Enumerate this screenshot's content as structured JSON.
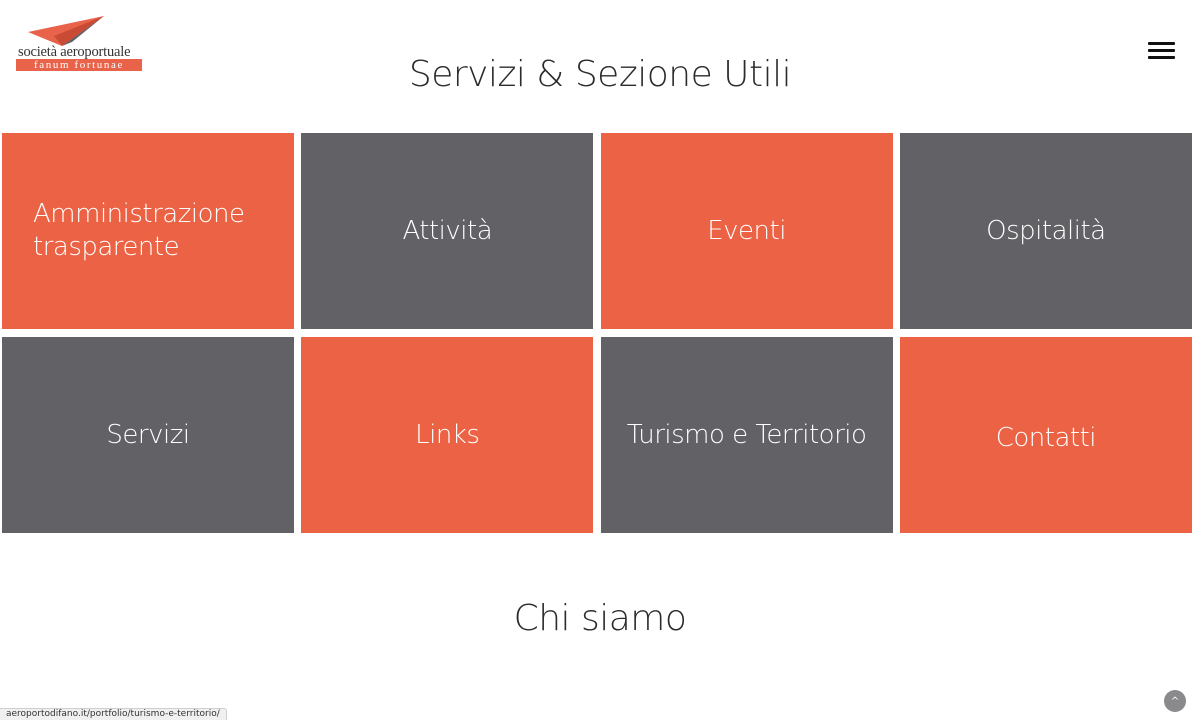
{
  "logo": {
    "line1": "società aeroportuale",
    "line2": "fanum fortunae"
  },
  "header": {
    "menu_icon": "hamburger-menu-icon"
  },
  "sections": {
    "services_title": "Servizi & Sezione Utili",
    "about_title": "Chi siamo"
  },
  "tiles": [
    {
      "label": "Amministrazione trasparente",
      "color": "#ec6245"
    },
    {
      "label": "Attività",
      "color": "#626166"
    },
    {
      "label": "Eventi",
      "color": "#ec6245"
    },
    {
      "label": "Ospitalità",
      "color": "#626166"
    },
    {
      "label": "Servizi",
      "color": "#626166"
    },
    {
      "label": "Links",
      "color": "#ec6245"
    },
    {
      "label": "Turismo e Territorio",
      "color": "#626166"
    },
    {
      "label": "Contatti",
      "color": "#ec6245"
    }
  ],
  "status_bar": {
    "url": "aeroportodifano.it/portfolio/turismo-e-territorio/"
  },
  "scroll_top": {
    "icon": "chevron-up-icon",
    "glyph": "^"
  },
  "colors": {
    "accent_orange": "#ec6245",
    "tile_gray": "#626166"
  }
}
